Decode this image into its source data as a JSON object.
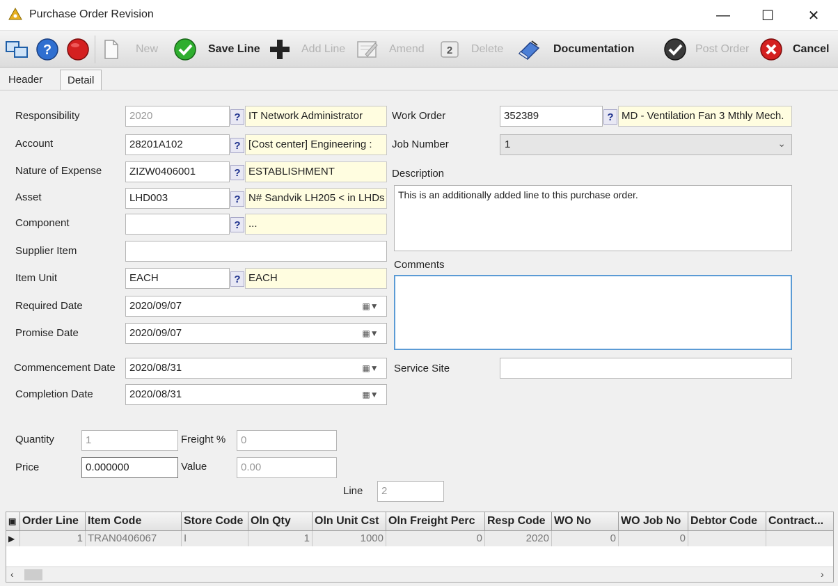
{
  "window": {
    "title": "Purchase Order Revision"
  },
  "toolbar": {
    "new": "New",
    "save_line": "Save Line",
    "add_line": "Add Line",
    "amend": "Amend",
    "delete": "Delete",
    "documentation": "Documentation",
    "post_order": "Post Order",
    "cancel": "Cancel"
  },
  "tabs": {
    "header": "Header",
    "detail": "Detail"
  },
  "form": {
    "responsibility": {
      "label": "Responsibility",
      "code": "2020",
      "desc": "IT Network Administrator"
    },
    "account": {
      "label": "Account",
      "code": "28201A102",
      "desc": "[Cost center]   Engineering :"
    },
    "nature_of_expense": {
      "label": "Nature of Expense",
      "code": "ZIZW0406001",
      "desc": "ESTABLISHMENT"
    },
    "asset": {
      "label": "Asset",
      "code": "LHD003",
      "desc": "N# Sandvik LH205 < in LHDs"
    },
    "component": {
      "label": "Component",
      "code": "",
      "desc": "..."
    },
    "supplier_item": {
      "label": "Supplier Item",
      "value": ""
    },
    "item_unit": {
      "label": "Item Unit",
      "code": "EACH",
      "desc": "EACH"
    },
    "required_date": {
      "label": "Required Date",
      "value": "2020/09/07"
    },
    "promise_date": {
      "label": "Promise Date",
      "value": "2020/09/07"
    },
    "commencement_date": {
      "label": "Commencement Date",
      "value": "2020/08/31"
    },
    "completion_date": {
      "label": "Completion Date",
      "value": "2020/08/31"
    },
    "quantity": {
      "label": "Quantity",
      "value": "1"
    },
    "freight": {
      "label": "Freight %",
      "value": "0"
    },
    "price": {
      "label": "Price",
      "value": "0.000000"
    },
    "value": {
      "label": "Value",
      "value": "0.00"
    },
    "line": {
      "label": "Line",
      "value": "2"
    },
    "work_order": {
      "label": "Work Order",
      "code": "352389",
      "desc": "MD - Ventilation Fan 3 Mthly Mech."
    },
    "job_number": {
      "label": "Job Number",
      "value": "1"
    },
    "description": {
      "label": "Description",
      "value": "This is an additionally added line to this purchase order."
    },
    "comments": {
      "label": "Comments",
      "value": ""
    },
    "service_site": {
      "label": "Service Site",
      "value": ""
    }
  },
  "grid": {
    "columns": [
      "Order Line",
      "Item Code",
      "Store Code",
      "Oln Qty",
      "Oln Unit Cst",
      "Oln Freight Perc",
      "Resp Code",
      "WO No",
      "WO Job No",
      "Debtor Code",
      "Contract..."
    ],
    "rows": [
      [
        "1",
        "TRAN0406067",
        "I",
        "1",
        "1000",
        "0",
        "2020",
        "0",
        "0",
        "",
        ""
      ]
    ]
  },
  "colors": {
    "accent": "#5b9bd5",
    "lookup_bg": "#fffde0",
    "disabled_text": "#b3b3b3"
  }
}
